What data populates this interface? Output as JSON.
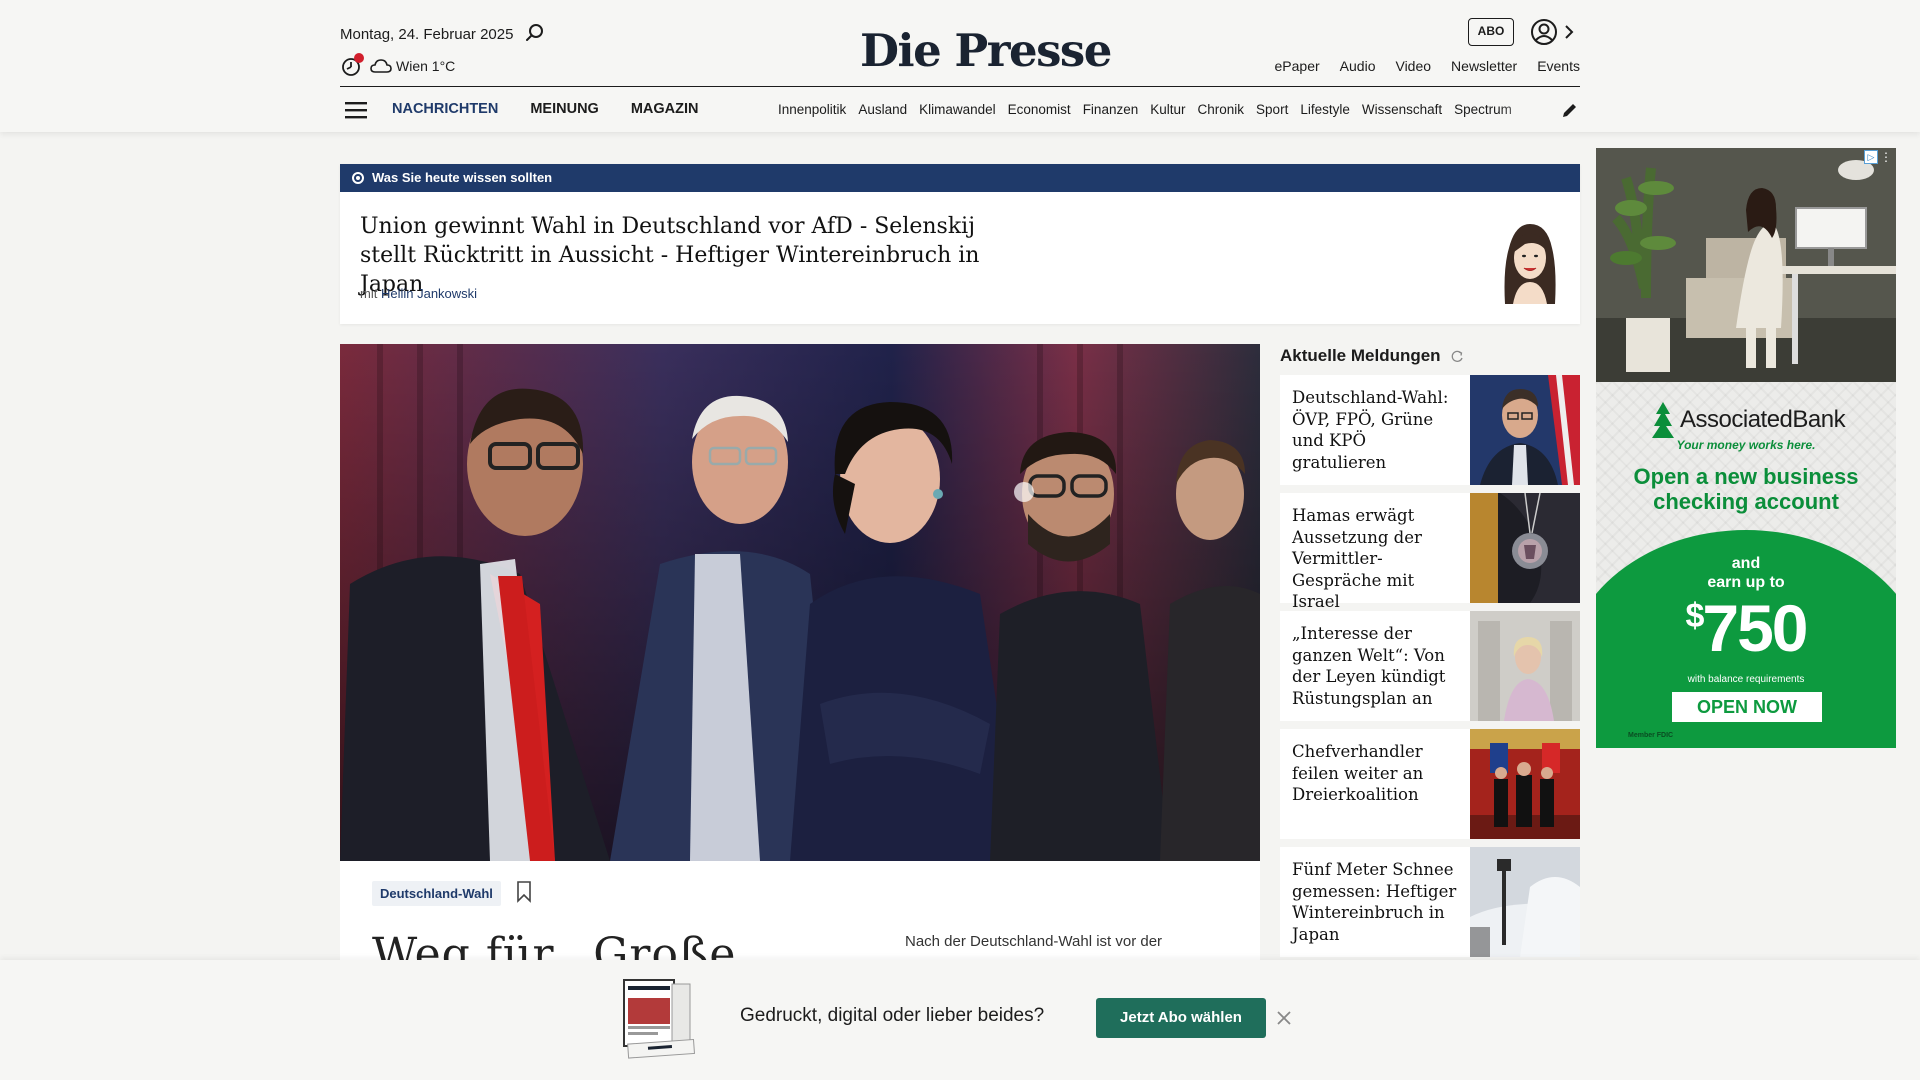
{
  "header": {
    "date": "Montag, 24. Februar 2025",
    "weather": "Wien 1°C",
    "logo": "Die Presse",
    "abo_label": "ABO",
    "top_links": [
      "ePaper",
      "Audio",
      "Video",
      "Newsletter",
      "Events"
    ],
    "main_nav": [
      "NACHRICHTEN",
      "MEINUNG",
      "MAGAZIN"
    ],
    "sub_nav": [
      "Innenpolitik",
      "Ausland",
      "Klimawandel",
      "Economist",
      "Finanzen",
      "Kultur",
      "Chronik",
      "Sport",
      "Lifestyle",
      "Wissenschaft",
      "Spectrum"
    ]
  },
  "briefing": {
    "label": "Was Sie heute wissen sollten",
    "title": "Union gewinnt Wahl in Deutschland vor AfD - Selenskij stellt Rücktritt in Aussicht - Heftiger Wintereinbruch in Japan",
    "by_prefix": "mit",
    "author": "Hellin Jankowski"
  },
  "article": {
    "tag": "Deutschland-Wahl",
    "headline": "Weg für „Große",
    "lead": "Nach der Deutschland-Wahl ist vor der"
  },
  "aktuell": {
    "heading": "Aktuelle Meldungen",
    "items": [
      {
        "title": "Deutschland-Wahl: ÖVP, FPÖ, Grüne und KPÖ gratulieren"
      },
      {
        "title": "Hamas erwägt Aussetzung der Vermittler-Gespräche mit Israel"
      },
      {
        "title": "„Interesse der ganzen Welt“: Von der Leyen kündigt Rüstungsplan an"
      },
      {
        "title": "Chefverhandler feilen weiter an Dreierkoalition"
      },
      {
        "title": "Fünf Meter Schnee gemessen: Heftiger Wintereinbruch in Japan"
      }
    ]
  },
  "ad": {
    "brand": "AssociatedBank",
    "tagline": "Your money works here.",
    "offer": "Open a new business checking account",
    "and_text": "and",
    "earn_text": "earn up to",
    "currency": "$",
    "amount": "750",
    "requirement": "with balance requirements",
    "cta": "OPEN NOW",
    "fdic": "Member FDIC",
    "brand_color": "#0d9a3f"
  },
  "subscribe": {
    "text": "Gedruckt, digital oder lieber beides?",
    "button": "Jetzt Abo wählen"
  },
  "colors": {
    "navy": "#1f3a6a",
    "button_green": "#1f6e5b",
    "alert_red": "#d11f2c"
  }
}
